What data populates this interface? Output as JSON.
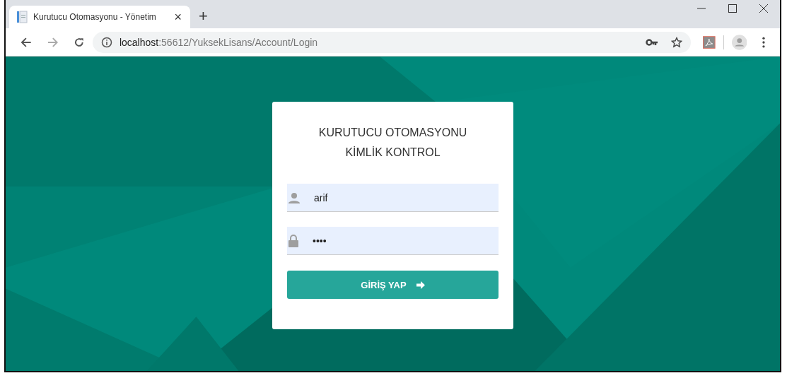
{
  "tab": {
    "title": "Kurutucu Otomasyonu - Yönetim",
    "close": "×"
  },
  "new_tab": "+",
  "address": {
    "host": "localhost",
    "path": ":56612/YuksekLisans/Account/Login"
  },
  "login": {
    "title_lines": [
      "KURUTUCU OTOMASYONU",
      "KİMLİK KONTROL"
    ],
    "fields": [
      {
        "kind": "user",
        "value": "arif"
      },
      {
        "kind": "password",
        "value": "••••"
      }
    ],
    "button": "GİRİŞ YAP"
  }
}
